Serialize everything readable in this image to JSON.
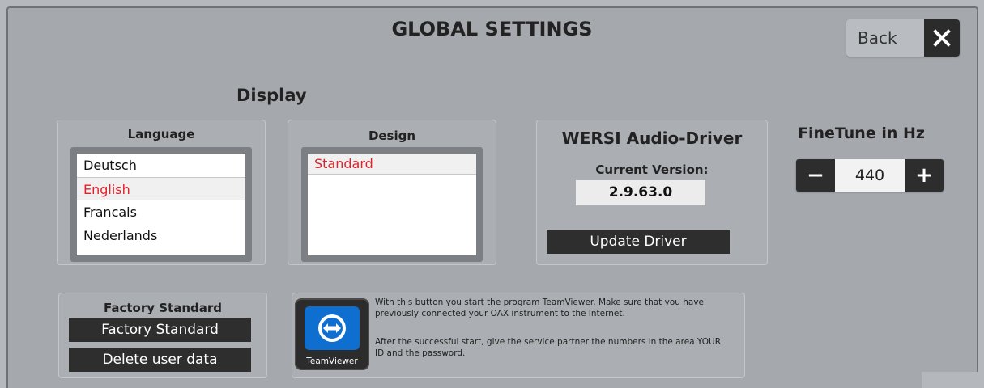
{
  "header": {
    "title": "GLOBAL SETTINGS",
    "back_label": "Back"
  },
  "display": {
    "title": "Display",
    "language": {
      "label": "Language",
      "options": [
        "Deutsch",
        "English",
        "Francais",
        "Nederlands"
      ],
      "selected": "English"
    },
    "design": {
      "label": "Design",
      "options": [
        "Standard"
      ],
      "selected": "Standard"
    }
  },
  "driver": {
    "title": "WERSI Audio-Driver",
    "current_version_label": "Current Version:",
    "version": "2.9.63.0",
    "update_label": "Update Driver"
  },
  "finetune": {
    "title": "FineTune in Hz",
    "value": "440",
    "minus": "−",
    "plus": "+"
  },
  "factory": {
    "title": "Factory Standard",
    "factory_button": "Factory Standard",
    "delete_button": "Delete user data"
  },
  "teamviewer": {
    "logo_text": "TeamViewer",
    "text1": "With this button you start the program TeamViewer. Make sure that you have previously connected your OAX instrument to the Internet.",
    "text2": "After the successful start, give the service partner the numbers in the area YOUR ID and the password."
  },
  "colors": {
    "selected_text": "#e0202a",
    "button_dark": "#2e2e2e",
    "teamviewer_blue": "#0e6fd1"
  }
}
